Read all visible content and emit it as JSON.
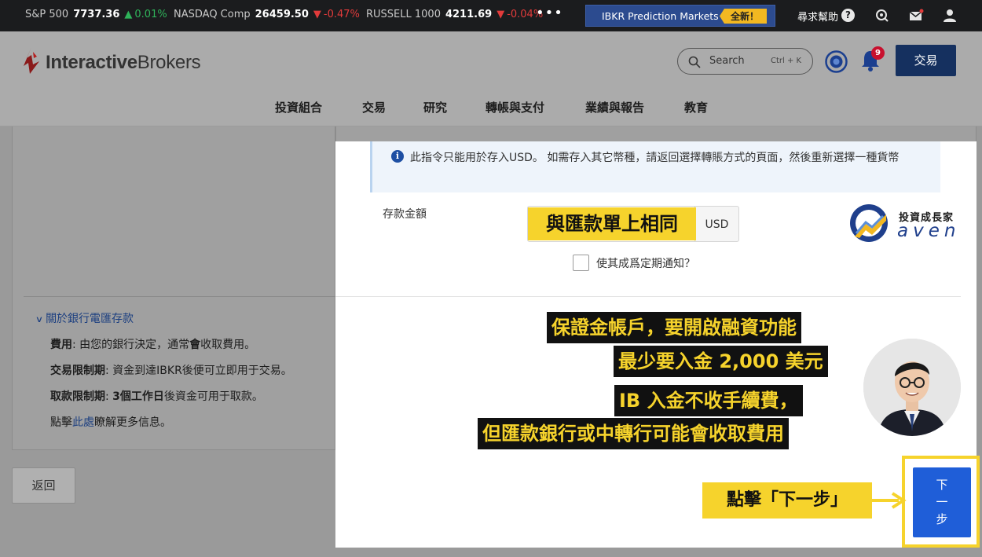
{
  "ticker": {
    "items": [
      {
        "name": "S&P 500",
        "value": "7737.36",
        "arrow": "▲",
        "change": "0.01%",
        "dir": "up"
      },
      {
        "name": "NASDAQ Comp",
        "value": "26459.50",
        "arrow": "▼",
        "change": "-0.47%",
        "dir": "down"
      },
      {
        "name": "RUSSELL 1000",
        "value": "4211.69",
        "arrow": "▼",
        "change": "-0.04%",
        "dir": "down"
      }
    ],
    "more": "•••",
    "banner_label": "IBKR Prediction Markets",
    "banner_badge": "全新！",
    "help_label": "尋求幫助",
    "help_icon": "?"
  },
  "header": {
    "logo_bold": "Interactive",
    "logo_rest": "Brokers",
    "search_placeholder": "Search",
    "search_shortcut": "Ctrl + K",
    "notification_count": "9",
    "trade_button": "交易",
    "nav": [
      "投資組合",
      "交易",
      "研究",
      "轉帳與支付",
      "業績與報告",
      "教育"
    ]
  },
  "left": {
    "title": "關於銀行電匯存款",
    "rows": [
      {
        "key": "費用",
        "text": ": 由您的銀行決定，通常",
        "bold": "會",
        "tail": "收取費用。"
      },
      {
        "key": "交易限制期",
        "text": ": 資金到達IBKR後便可立即用于交易。",
        "bold": "",
        "tail": ""
      },
      {
        "key": "取款限制期",
        "text": ": ",
        "bold": "3個工作日",
        "tail": "後資金可用于取款。"
      }
    ],
    "more_prefix": "點擊",
    "more_link": "此處",
    "more_suffix": "瞭解更多信息。",
    "back_button": "返回"
  },
  "form": {
    "notice_icon": "i",
    "notice": "此指令只能用於存入USD。 如需存入其它幣種，請返回選擇轉賬方式的頁面，然後重新選擇一種貨幣",
    "amount_label": "存款金額",
    "currency": "USD",
    "recurring_label": "使其成爲定期通知？"
  },
  "overlay": {
    "amount_highlight": "與匯款單上相同",
    "brand_cn": "投資成長家",
    "brand_en": "aven",
    "lines": [
      "保證金帳戶，要開啟融資功能",
      "最少要入金 2,000 美元",
      "IB  入金不收手續費，",
      "但匯款銀行或中轉行可能會收取費用"
    ],
    "click_label": "點擊「下一步」",
    "next_button": [
      "下",
      "一",
      "步"
    ]
  },
  "colors": {
    "ticker_bg": "#1b1c1e",
    "up": "#2fb35a",
    "down": "#e23b3b",
    "brand_navy": "#15305f",
    "next_blue": "#1f5ed8",
    "highlight_yellow": "#f6d32c",
    "link_blue": "#1c3f80"
  }
}
